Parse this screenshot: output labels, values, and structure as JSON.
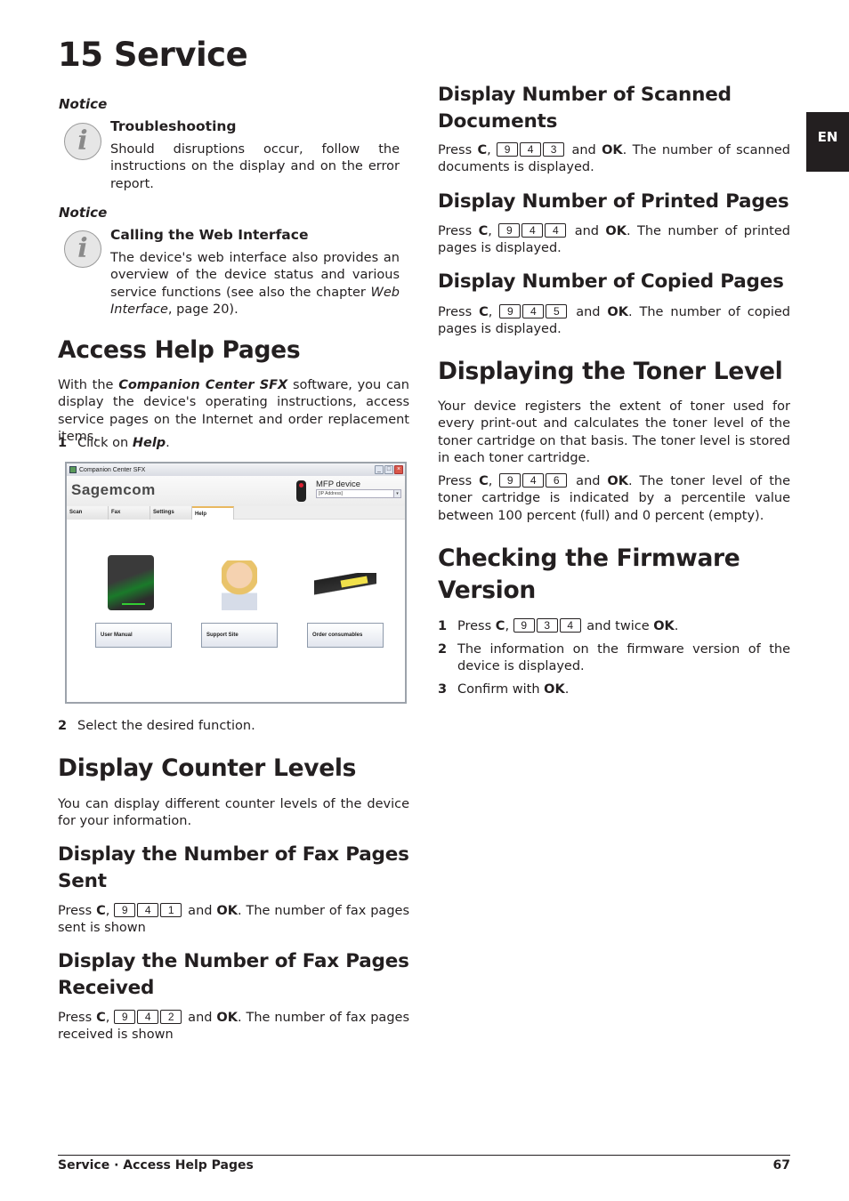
{
  "chapter": {
    "title": "15 Service"
  },
  "language_tab": "EN",
  "notices": [
    {
      "label": "Notice",
      "icon": "info-icon",
      "heading": "Troubleshooting",
      "body": "Should disruptions occur, follow the instructions on the display and on the error report."
    },
    {
      "label": "Notice",
      "icon": "info-icon",
      "heading": "Calling the Web Interface",
      "body_pre": "The device's web interface also provides an overview of the device status and various service functions (see also the chapter ",
      "body_link": "Web Interface",
      "body_post": ", page 20)."
    }
  ],
  "access_help": {
    "heading": "Access Help Pages",
    "intro_pre": "With the ",
    "intro_bold": "Companion Center SFX",
    "intro_post": " software, you can display the device's operating instructions, access service pages on the Internet and order replacement items.",
    "step1_num": "1",
    "step1_pre": "Click on ",
    "step1_bold": "Help",
    "step1_post": ".",
    "step2_num": "2",
    "step2_text": "Select the desired function."
  },
  "screenshot": {
    "window_title": "Companion Center SFX",
    "logo": "Sagemcom",
    "device_label": "MFP device",
    "ip_placeholder": "[IP Address]",
    "tabs": [
      "Scan",
      "Fax",
      "Settings",
      "Help"
    ],
    "active_tab": "Help",
    "buttons": [
      "User Manual",
      "Support Site",
      "Order consumables"
    ],
    "images": [
      "user-guide-image",
      "support-agent-image",
      "toner-cartridge-image"
    ],
    "win_controls": {
      "minimize": "_",
      "maximize": "□",
      "close": "×"
    }
  },
  "counter_levels": {
    "heading": "Display Counter Levels",
    "intro": "You can display different counter levels of the device for your information."
  },
  "sections": {
    "fax_sent": {
      "heading": "Display the Number of Fax Pages Sent",
      "press": "Press ",
      "c": "C",
      "comma": ", ",
      "keys": [
        "9",
        "4",
        "1"
      ],
      "and": " and ",
      "ok": "OK",
      "rest": ". The number of fax pages sent is shown"
    },
    "fax_received": {
      "heading": "Display the Number of Fax Pages Received",
      "press": "Press ",
      "c": "C",
      "comma": ", ",
      "keys": [
        "9",
        "4",
        "2"
      ],
      "and": " and ",
      "ok": "OK",
      "rest": ". The number of fax pages received is shown"
    },
    "scanned": {
      "heading": "Display Number of Scanned Documents",
      "press": "Press ",
      "c": "C",
      "comma": ", ",
      "keys": [
        "9",
        "4",
        "3"
      ],
      "and": " and ",
      "ok": "OK",
      "rest": ". The number of scanned documents is displayed."
    },
    "printed": {
      "heading": "Display Number of Printed Pages",
      "press": "Press ",
      "c": "C",
      "comma": ", ",
      "keys": [
        "9",
        "4",
        "4"
      ],
      "and": " and ",
      "ok": "OK",
      "rest": ". The number of printed pages is displayed."
    },
    "copied": {
      "heading": "Display Number of Copied Pages",
      "press": "Press ",
      "c": "C",
      "comma": ", ",
      "keys": [
        "9",
        "4",
        "5"
      ],
      "and": " and ",
      "ok": "OK",
      "rest": ". The number of copied pages is displayed."
    }
  },
  "toner": {
    "heading": "Displaying the Toner Level",
    "intro": "Your device registers the extent of toner used for every print-out and calculates the toner level of the toner cartridge on that basis. The toner level is stored in each toner cartridge.",
    "press": "Press ",
    "c": "C",
    "comma": ", ",
    "keys": [
      "9",
      "4",
      "6"
    ],
    "and": " and ",
    "ok": "OK",
    "rest": ". The toner level of the toner cartridge is indicated by a percentile value between 100 percent (full) and 0 percent (empty)."
  },
  "firmware": {
    "heading": "Checking the Firmware Version",
    "step1_num": "1",
    "step1_press": "Press ",
    "step1_c": "C",
    "step1_comma": ", ",
    "step1_keys": [
      "9",
      "3",
      "4"
    ],
    "step1_and": " and twice ",
    "step1_ok": "OK",
    "step1_end": ".",
    "step2_num": "2",
    "step2_text": "The information on the firmware version of the device is displayed.",
    "step3_num": "3",
    "step3_pre": "Confirm with ",
    "step3_ok": "OK",
    "step3_end": "."
  },
  "footer": {
    "breadcrumb": "Service · Access Help Pages",
    "page_number": "67"
  }
}
